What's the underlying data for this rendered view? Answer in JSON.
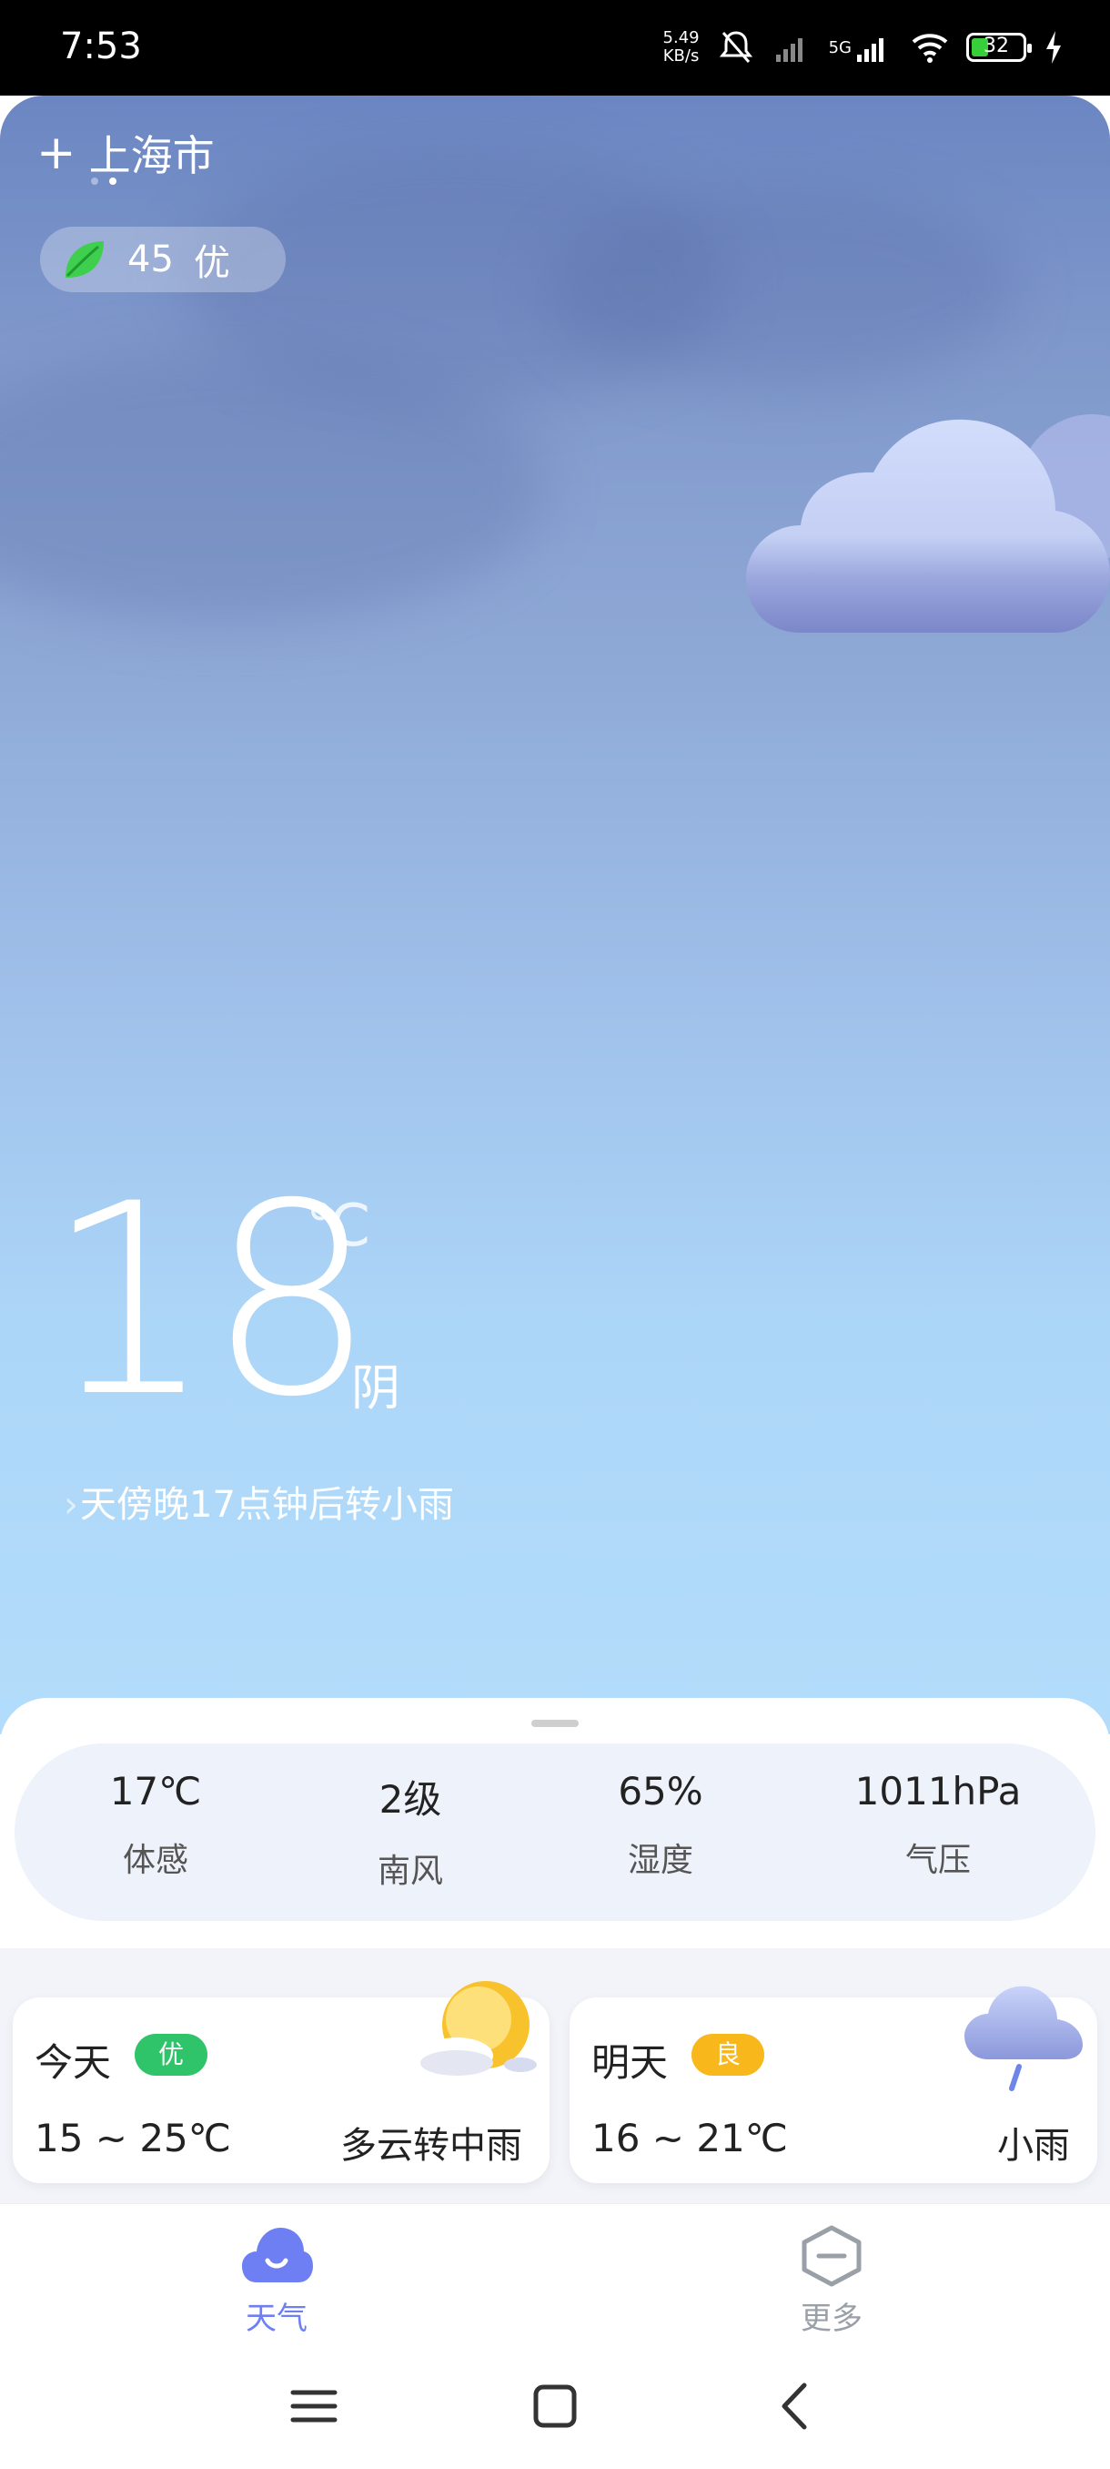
{
  "status_bar": {
    "time": "7:53",
    "net_speed_value": "5.49",
    "net_speed_unit": "KB/s",
    "network": "5G",
    "battery": "32"
  },
  "header": {
    "city": "上海市",
    "aqi_value": "45",
    "aqi_level": "优"
  },
  "current": {
    "temperature": "18",
    "unit": "℃",
    "condition": "阴",
    "forecast_note": "天傍晚17点钟后转小雨"
  },
  "details": [
    {
      "value": "17℃",
      "label": "体感"
    },
    {
      "value": "2级",
      "label": "南风"
    },
    {
      "value": "65%",
      "label": "湿度"
    },
    {
      "value": "1011hPa",
      "label": "气压"
    }
  ],
  "days": [
    {
      "name": "今天",
      "badge": "优",
      "range": "15 ~ 25℃",
      "condition": "多云转中雨",
      "badge_color": "#2fc46a"
    },
    {
      "name": "明天",
      "badge": "良",
      "range": "16 ~ 21℃",
      "condition": "小雨",
      "badge_color": "#f8b81c"
    }
  ],
  "nav": {
    "weather_label": "天气",
    "more_label": "更多",
    "active_color": "#6e7ff3",
    "inactive_color": "#9aa0a8"
  }
}
